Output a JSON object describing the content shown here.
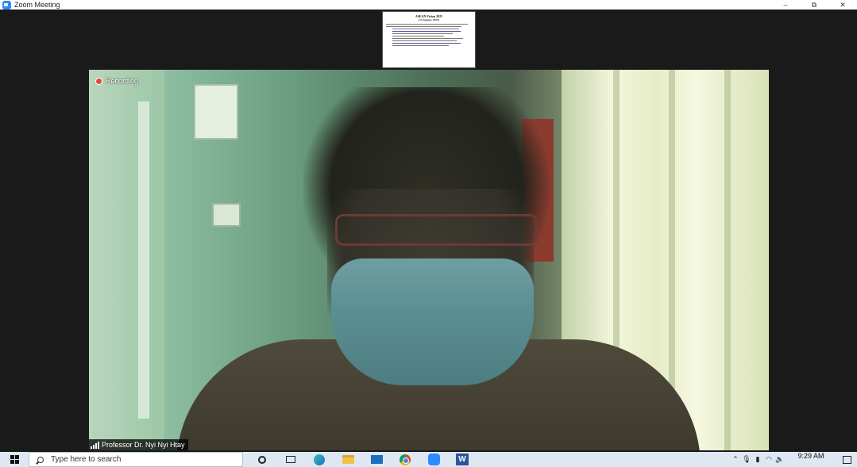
{
  "window": {
    "title": "Zoom Meeting",
    "controls": {
      "minimize": "–",
      "restore": "⧉",
      "close": "✕"
    }
  },
  "share_preview": {
    "title": "ASEAN Vision 2025",
    "subtitle": "(13 August, 2025)"
  },
  "video": {
    "recording_label": "Recording",
    "participant_name": "Professor Dr. Nyi Nyi Htay"
  },
  "taskbar": {
    "search_placeholder": "Type here to search",
    "clock_time": "9:29 AM",
    "word_label": "W",
    "apps": [
      "cortana-icon",
      "task-view-icon",
      "edge-icon",
      "file-explorer-icon",
      "mail-icon",
      "chrome-icon",
      "zoom-icon",
      "word-icon"
    ]
  },
  "colors": {
    "zoom_blue": "#2d8cff",
    "recording_red": "#e5463a",
    "taskbar_bg": "#dfe8f2",
    "window_bg": "#1a1a1a"
  }
}
